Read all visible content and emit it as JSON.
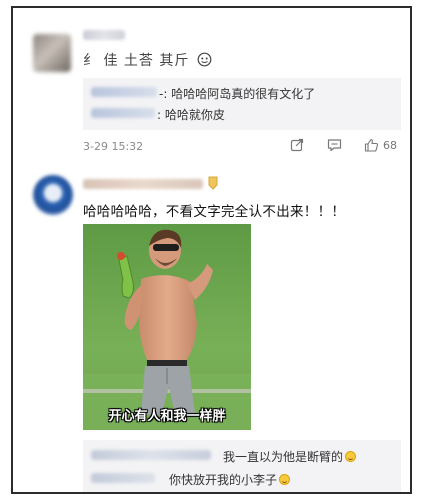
{
  "comment1": {
    "username": "纟 佳 土荅 其斤",
    "replies": [
      {
        "text": "-: 哈哈哈阿岛真的很有文化了"
      },
      {
        "text": ": 哈哈就你皮"
      }
    ],
    "timestamp": "3-29 15:32",
    "like_count": "68"
  },
  "comment2": {
    "text": "哈哈哈哈哈，不看文字完全认不出来！！！",
    "image_caption": "开心有人和我一样胖",
    "replies": [
      {
        "text": "我一直以为他是断臂的"
      },
      {
        "text": "你快放开我的小李子"
      }
    ]
  },
  "icons": [
    "share-icon",
    "reply-icon",
    "like-icon",
    "badge-icon",
    "laugh-emoji-icon"
  ],
  "colors": {
    "quote_bg": "#f3f3f5",
    "meta_text": "#8a8a8a",
    "badge": "#f0c65a"
  }
}
